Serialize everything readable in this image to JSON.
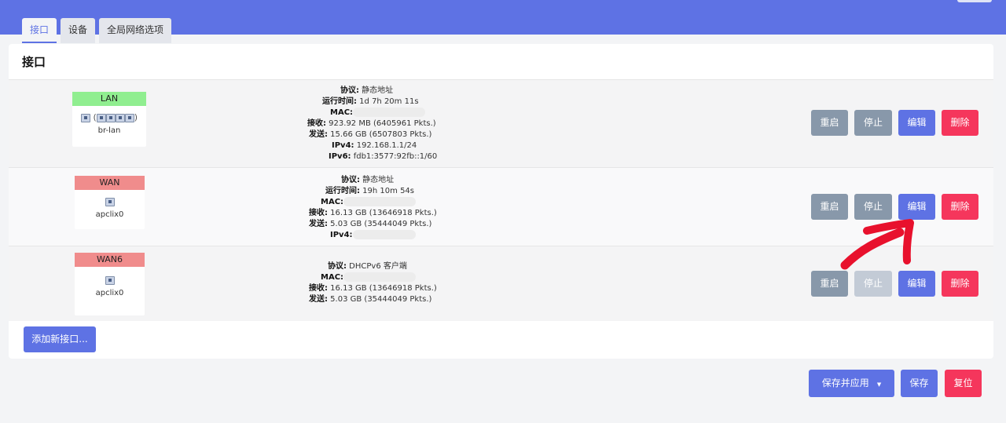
{
  "tabs": [
    "接口",
    "设备",
    "全局网络选项"
  ],
  "panel_title": "接口",
  "interfaces": [
    {
      "name": "LAN",
      "name_color": "#90ee90",
      "device": "br-lan",
      "lines": [
        {
          "label": "协议:",
          "value": " 静态地址"
        },
        {
          "label": "运行时间:",
          "value": " 1d 7h 20m 11s"
        },
        {
          "label": "MAC:",
          "value": ""
        },
        {
          "label": "接收:",
          "value": " 923.92 MB (6405961 Pkts.)"
        },
        {
          "label": "发送:",
          "value": " 15.66 GB (6507803 Pkts.)"
        },
        {
          "label": "IPv4:",
          "value": " 192.168.1.1/24"
        },
        {
          "label": "IPv6:",
          "value": " fdb1:3577:92fb::1/60"
        }
      ]
    },
    {
      "name": "WAN",
      "name_color": "#f08c8c",
      "device": "apclix0",
      "lines": [
        {
          "label": "协议:",
          "value": " 静态地址"
        },
        {
          "label": "运行时间:",
          "value": " 19h 10m 54s"
        },
        {
          "label": "MAC:",
          "value": ""
        },
        {
          "label": "接收:",
          "value": " 16.13 GB (13646918 Pkts.)"
        },
        {
          "label": "发送:",
          "value": " 5.03 GB (35444049 Pkts.)"
        },
        {
          "label": "IPv4:",
          "value": ""
        }
      ]
    },
    {
      "name": "WAN6",
      "name_color": "#f08c8c",
      "device": "apclix0",
      "lines": [
        {
          "label": "协议:",
          "value": " DHCPv6 客户端"
        },
        {
          "label": "MAC:",
          "value": ""
        },
        {
          "label": "接收:",
          "value": " 16.13 GB (13646918 Pkts.)"
        },
        {
          "label": "发送:",
          "value": " 5.03 GB (35444049 Pkts.)"
        }
      ]
    }
  ],
  "actions": {
    "restart": "重启",
    "stop": "停止",
    "edit": "编辑",
    "delete": "删除"
  },
  "add_interface": "添加新接口...",
  "footer": {
    "save_apply": "保存并应用",
    "save": "保存",
    "reset": "复位"
  },
  "colors": {
    "header": "#5e72e4",
    "primary": "#5e72e4",
    "danger": "#f5365c",
    "secondary": "#8898aa",
    "annotation_arrow": "#e8112d"
  }
}
